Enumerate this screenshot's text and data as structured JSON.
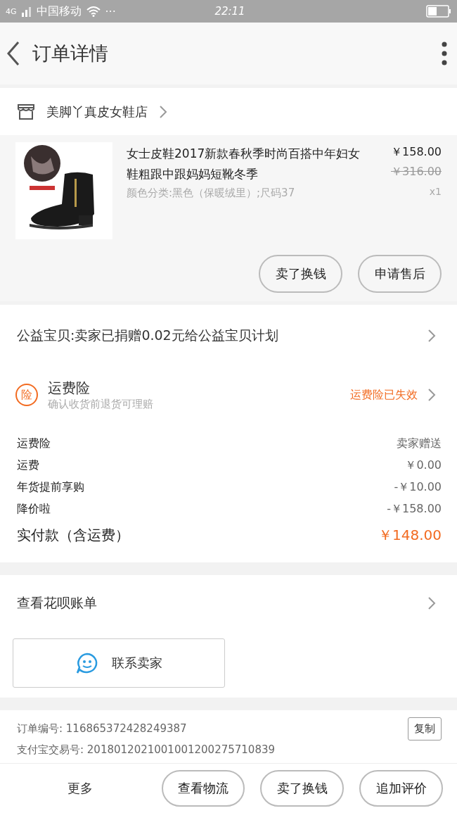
{
  "status_bar": {
    "network": "4G",
    "carrier": "中国移动",
    "dots": "···",
    "time": "22:11"
  },
  "header": {
    "title": "订单详情"
  },
  "shop": {
    "name": "美脚丫真皮女鞋店"
  },
  "product": {
    "title": "女士皮鞋2017新款春秋季时尚百搭中年妇女鞋粗跟中跟妈妈短靴冬季",
    "sku": "颜色分类:黑色（保暖绒里）;尺码37",
    "price": "￥158.00",
    "original_price": "￥316.00",
    "quantity": "x1",
    "buttons": [
      "卖了换钱",
      "申请售后"
    ]
  },
  "charity": {
    "text": "公益宝贝:卖家已捐赠0.02元给公益宝贝计划"
  },
  "insurance": {
    "badge": "险",
    "title": "运费险",
    "subtitle": "确认收货前退货可理赔",
    "status": "运费险已失效"
  },
  "fees": [
    {
      "label": "运费险",
      "value": "卖家赠送",
      "kind": "plain"
    },
    {
      "label": "运费",
      "value": "￥0.00",
      "kind": "plain"
    },
    {
      "label": "年货提前享购",
      "value": "-￥10.00",
      "kind": "plain"
    },
    {
      "label": "降价啦",
      "value": "-￥158.00",
      "kind": "plain"
    },
    {
      "label": "实付款（含运费）",
      "value": "￥148.00",
      "kind": "total"
    }
  ],
  "huabei": {
    "text": "查看花呗账单"
  },
  "contact": {
    "label": "联系卖家"
  },
  "order_info": {
    "order_no": "订单编号: 116865372428249387",
    "copy": "复制",
    "trade_no": "支付宝交易号: 2018012021001001200275710839"
  },
  "bottom_bar": {
    "more": "更多",
    "buttons": [
      "查看物流",
      "卖了换钱",
      "追加评价"
    ]
  }
}
